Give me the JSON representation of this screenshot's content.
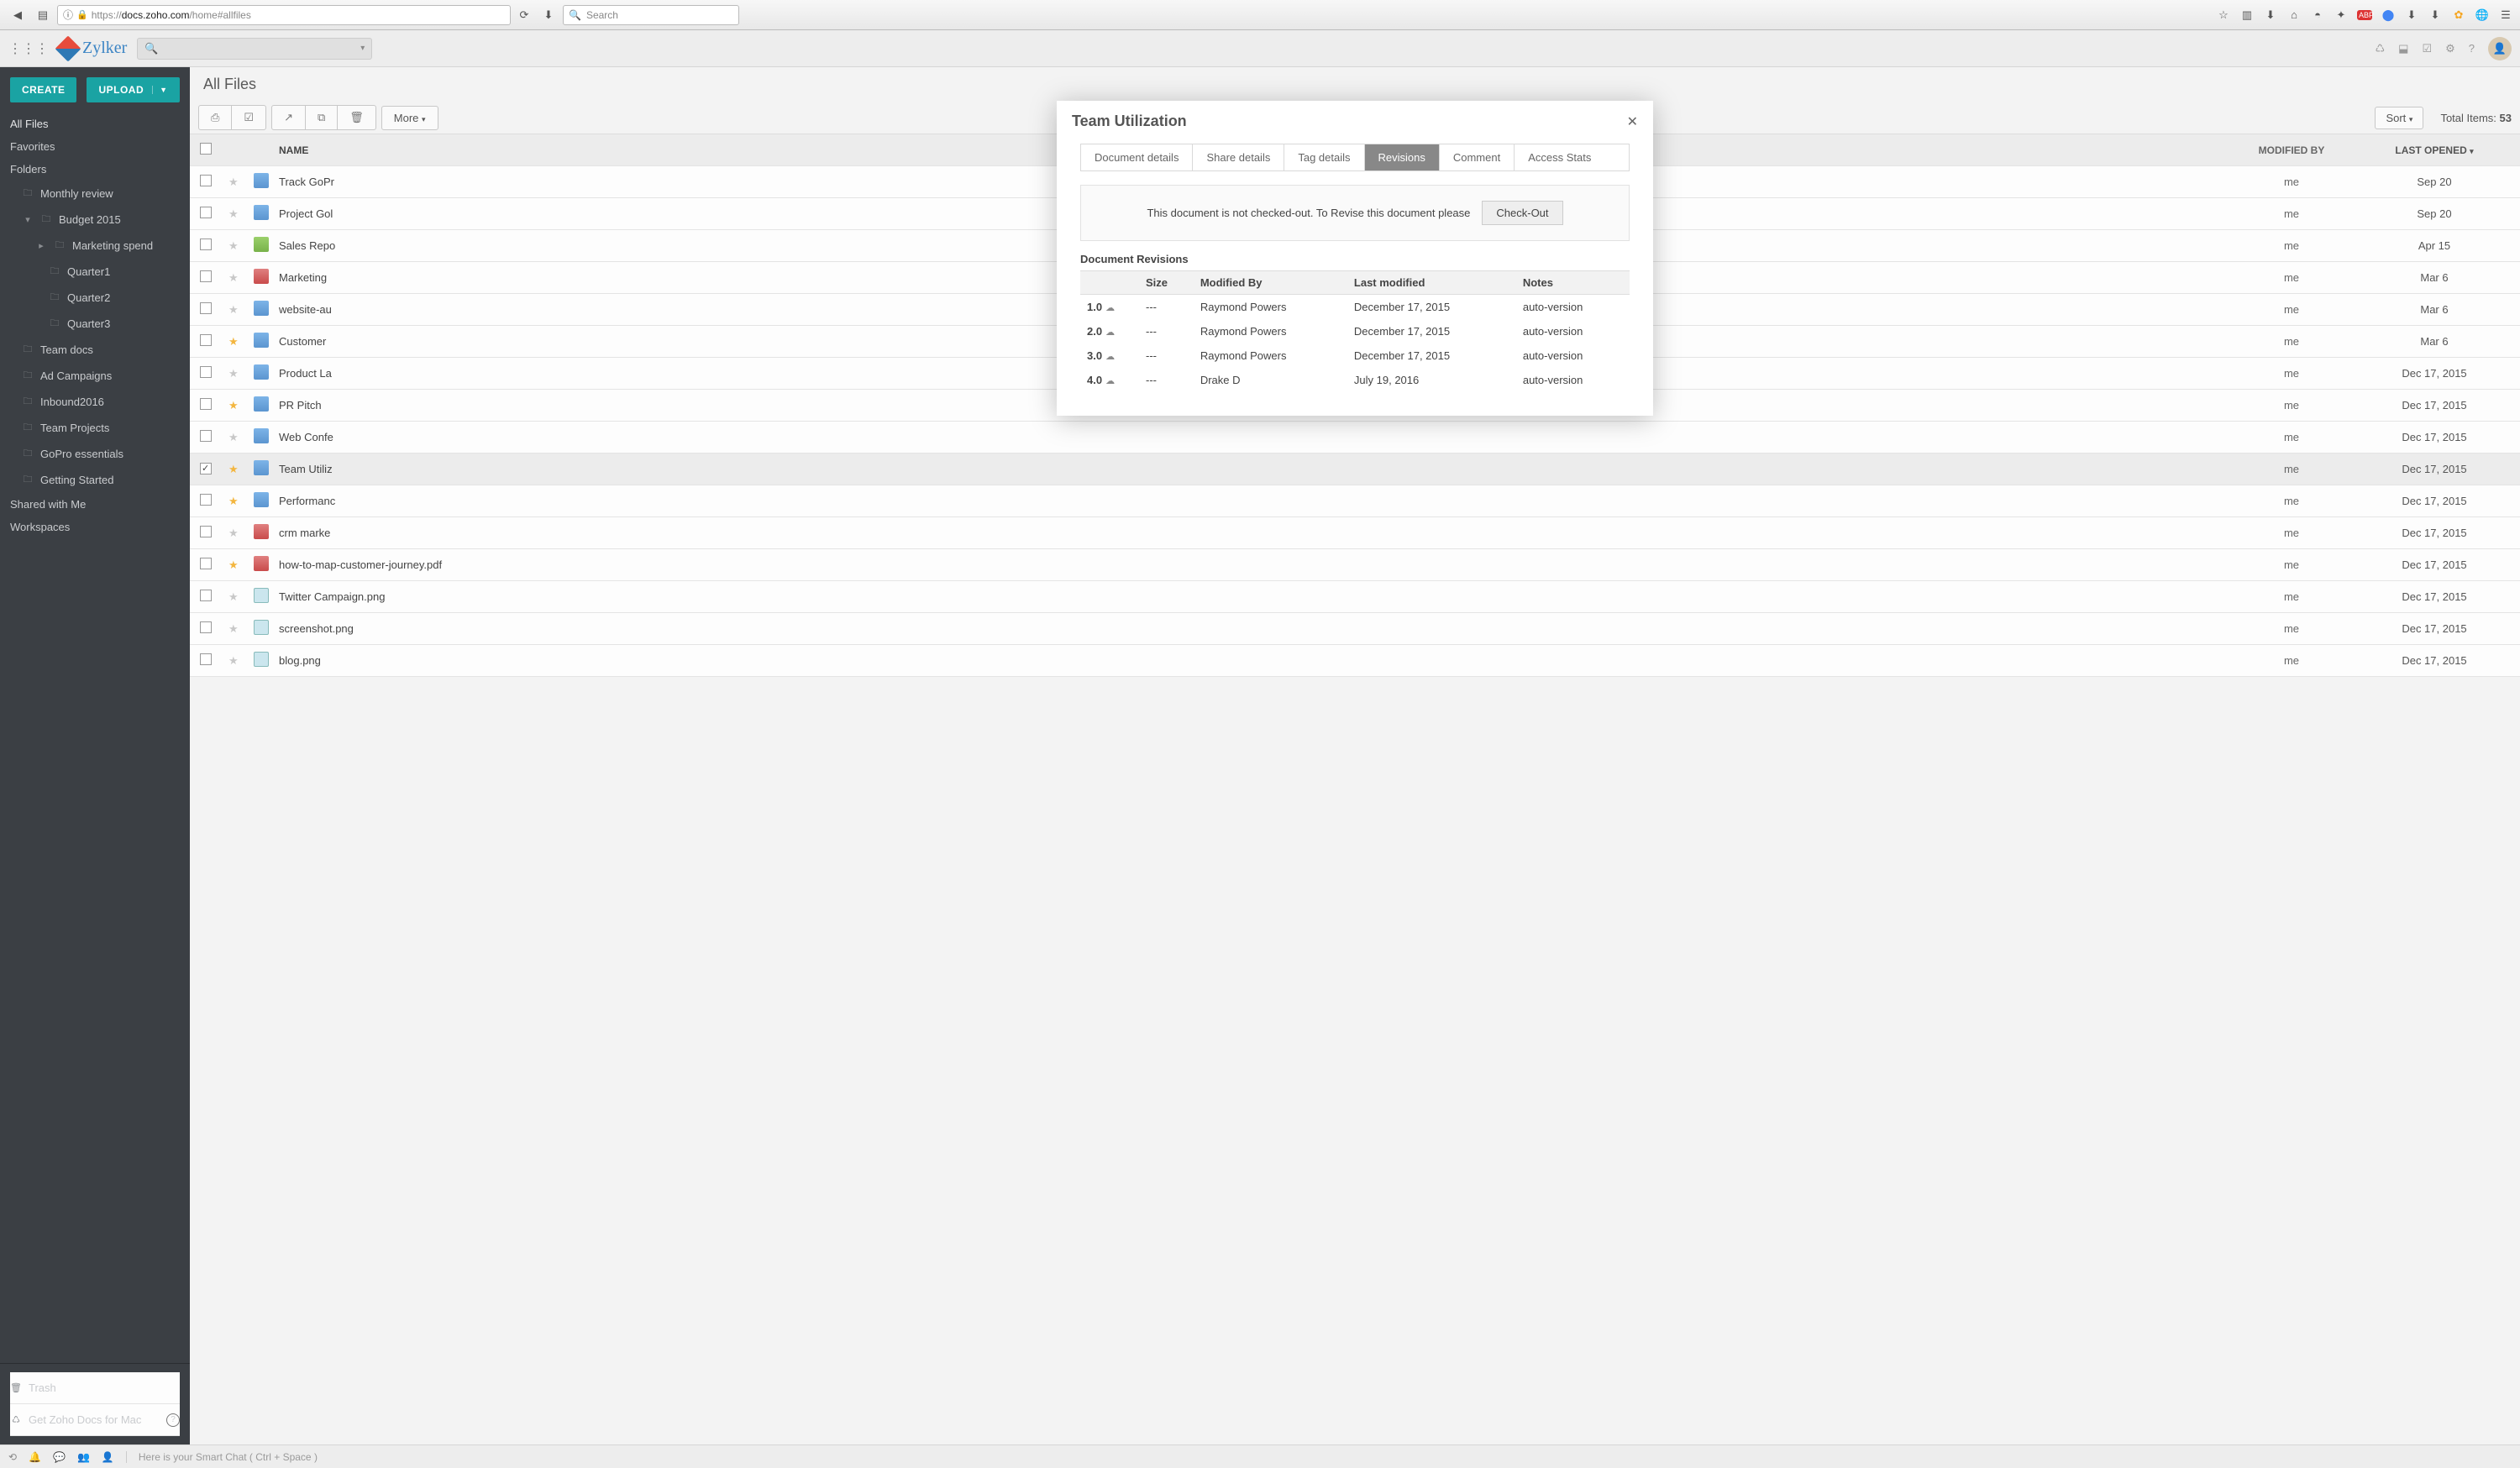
{
  "browser": {
    "url_prefix": "https://",
    "url_host": "docs.zoho.com",
    "url_path": "/home#allfiles",
    "search_placeholder": "Search"
  },
  "app": {
    "brand": "Zylker"
  },
  "sidebar": {
    "create": "CREATE",
    "upload": "UPLOAD",
    "all_files": "All Files",
    "favorites": "Favorites",
    "folders": "Folders",
    "monthly_review": "Monthly review",
    "budget_2015": "Budget 2015",
    "marketing_spend": "Marketing spend",
    "q1": "Quarter1",
    "q2": "Quarter2",
    "q3": "Quarter3",
    "team_docs": "Team docs",
    "ad_campaigns": "Ad Campaigns",
    "inbound2016": "Inbound2016",
    "team_projects": "Team Projects",
    "gopro": "GoPro essentials",
    "getting_started": "Getting Started",
    "shared": "Shared with Me",
    "workspaces": "Workspaces",
    "trash": "Trash",
    "get_mac": "Get Zoho Docs for Mac"
  },
  "header": {
    "breadcrumb": "All Files",
    "more": "More",
    "sort": "Sort",
    "total_label": "Total Items:",
    "total_count": "53"
  },
  "columns": {
    "name": "NAME",
    "modified_by": "MODIFIED BY",
    "last_opened": "LAST OPENED"
  },
  "files": [
    {
      "name": "Track GoPr",
      "mod": "me",
      "date": "Sep 20",
      "star": false,
      "icon": "doc",
      "sel": false
    },
    {
      "name": "Project Gol",
      "mod": "me",
      "date": "Sep 20",
      "star": false,
      "icon": "doc",
      "sel": false
    },
    {
      "name": "Sales Repo",
      "mod": "me",
      "date": "Apr 15",
      "star": false,
      "icon": "sheet",
      "sel": false
    },
    {
      "name": "Marketing",
      "mod": "me",
      "date": "Mar 6",
      "star": false,
      "icon": "pdf",
      "sel": false
    },
    {
      "name": "website-au",
      "mod": "me",
      "date": "Mar 6",
      "star": false,
      "icon": "doc",
      "sel": false
    },
    {
      "name": "Customer",
      "mod": "me",
      "date": "Mar 6",
      "star": true,
      "icon": "doc",
      "sel": false
    },
    {
      "name": "Product La",
      "mod": "me",
      "date": "Dec 17, 2015",
      "star": false,
      "icon": "doc",
      "sel": false
    },
    {
      "name": "PR Pitch",
      "mod": "me",
      "date": "Dec 17, 2015",
      "star": true,
      "icon": "doc",
      "sel": false
    },
    {
      "name": "Web Confe",
      "mod": "me",
      "date": "Dec 17, 2015",
      "star": false,
      "icon": "doc",
      "sel": false
    },
    {
      "name": "Team Utiliz",
      "mod": "me",
      "date": "Dec 17, 2015",
      "star": true,
      "icon": "doc",
      "sel": true
    },
    {
      "name": "Performanc",
      "mod": "me",
      "date": "Dec 17, 2015",
      "star": true,
      "icon": "doc",
      "sel": false
    },
    {
      "name": "crm marke",
      "mod": "me",
      "date": "Dec 17, 2015",
      "star": false,
      "icon": "pdf",
      "sel": false
    },
    {
      "name": "how-to-map-customer-journey.pdf",
      "mod": "me",
      "date": "Dec 17, 2015",
      "star": true,
      "icon": "pdf",
      "sel": false
    },
    {
      "name": "Twitter Campaign.png",
      "mod": "me",
      "date": "Dec 17, 2015",
      "star": false,
      "icon": "img",
      "sel": false
    },
    {
      "name": "screenshot.png",
      "mod": "me",
      "date": "Dec 17, 2015",
      "star": false,
      "icon": "img",
      "sel": false
    },
    {
      "name": "blog.png",
      "mod": "me",
      "date": "Dec 17, 2015",
      "star": false,
      "icon": "img",
      "sel": false
    }
  ],
  "modal": {
    "title": "Team Utilization",
    "tabs": [
      "Document details",
      "Share details",
      "Tag details",
      "Revisions",
      "Comment",
      "Access Stats"
    ],
    "active_tab": 3,
    "checkout_msg": "This document is not checked-out. To Revise this document please",
    "checkout_btn": "Check-Out",
    "rev_heading": "Document Revisions",
    "rev_cols": {
      "size": "Size",
      "modified_by": "Modified By",
      "last_modified": "Last modified",
      "notes": "Notes"
    },
    "revisions": [
      {
        "ver": "1.0",
        "size": "---",
        "by": "Raymond Powers",
        "date": "December 17, 2015",
        "notes": "auto-version"
      },
      {
        "ver": "2.0",
        "size": "---",
        "by": "Raymond Powers",
        "date": "December 17, 2015",
        "notes": "auto-version"
      },
      {
        "ver": "3.0",
        "size": "---",
        "by": "Raymond Powers",
        "date": "December 17, 2015",
        "notes": "auto-version"
      },
      {
        "ver": "4.0",
        "size": "---",
        "by": "Drake D",
        "date": "July 19, 2016",
        "notes": "auto-version"
      }
    ]
  },
  "bottombar": {
    "chat": "Here is your Smart Chat ( Ctrl + Space )"
  }
}
